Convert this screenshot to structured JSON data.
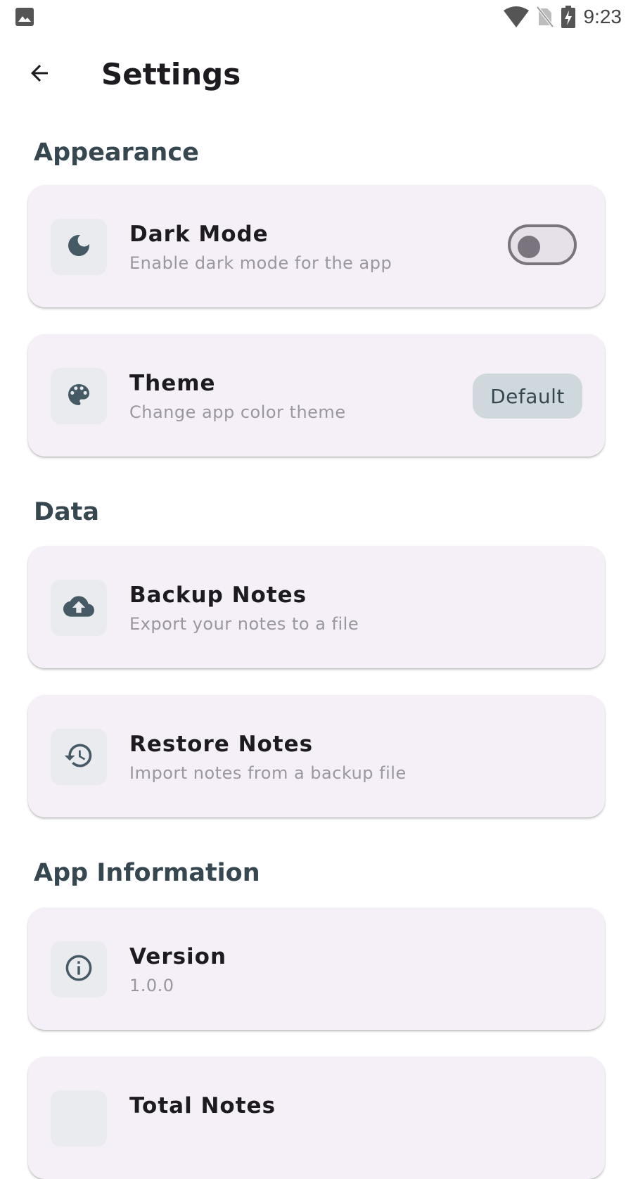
{
  "status_bar": {
    "time": "9:23",
    "left_icon": "image-icon",
    "icons": [
      "wifi-icon",
      "no-sim-icon",
      "battery-charging-icon"
    ]
  },
  "header": {
    "back_icon": "arrow-back-icon",
    "title": "Settings"
  },
  "sections": {
    "appearance": {
      "title": "Appearance",
      "dark_mode": {
        "icon": "moon-icon",
        "title": "Dark Mode",
        "subtitle": "Enable dark mode for the app",
        "toggle_on": false
      },
      "theme": {
        "icon": "palette-icon",
        "title": "Theme",
        "subtitle": "Change app color theme",
        "value": "Default"
      }
    },
    "data": {
      "title": "Data",
      "backup": {
        "icon": "cloud-upload-icon",
        "title": "Backup Notes",
        "subtitle": "Export your notes to a file"
      },
      "restore": {
        "icon": "restore-history-icon",
        "title": "Restore Notes",
        "subtitle": "Import notes from a backup file"
      }
    },
    "app_info": {
      "title": "App Information",
      "version": {
        "icon": "info-icon",
        "title": "Version",
        "subtitle": "1.0.0"
      },
      "total_notes": {
        "title": "Total Notes"
      }
    }
  },
  "colors": {
    "section_title": "#37474f",
    "card_background": "#f5f0f7",
    "icon_tile": "#e9ebee",
    "icon_color": "#455a64",
    "chip_background": "#cfd8dc",
    "toggle_outline": "#79747e"
  }
}
